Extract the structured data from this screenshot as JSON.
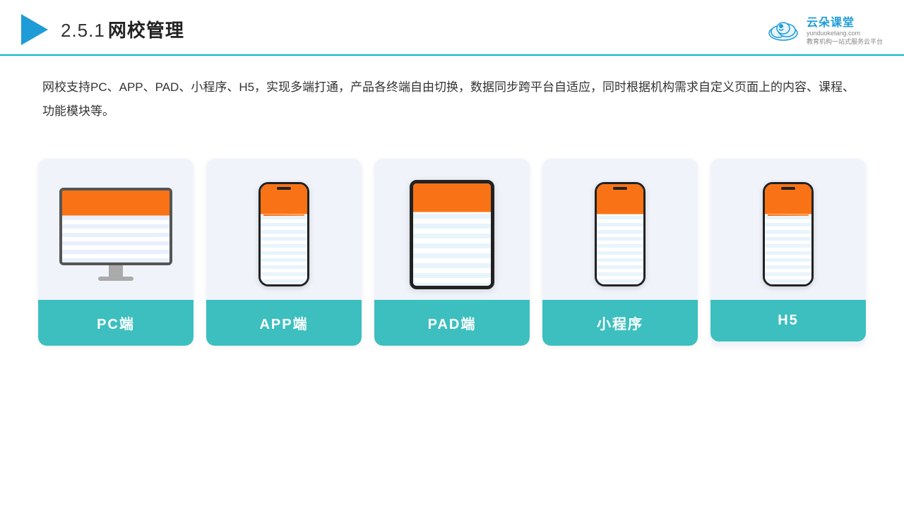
{
  "header": {
    "section_number": "2.5.1",
    "title": "网校管理",
    "brand_name": "云朵课堂",
    "brand_url": "yunduoketang.com",
    "brand_tagline": "教育机构一站\n式服务云平台"
  },
  "description": {
    "text": "网校支持PC、APP、PAD、小程序、H5，实现多端打通，产品各终端自由切换，数据同步跨平台自适应，同时根据机构需求自定义页面上的内容、课程、功能模块等。"
  },
  "cards": [
    {
      "id": "pc",
      "label": "PC端"
    },
    {
      "id": "app",
      "label": "APP端"
    },
    {
      "id": "pad",
      "label": "PAD端"
    },
    {
      "id": "miniprogram",
      "label": "小程序"
    },
    {
      "id": "h5",
      "label": "H5"
    }
  ]
}
